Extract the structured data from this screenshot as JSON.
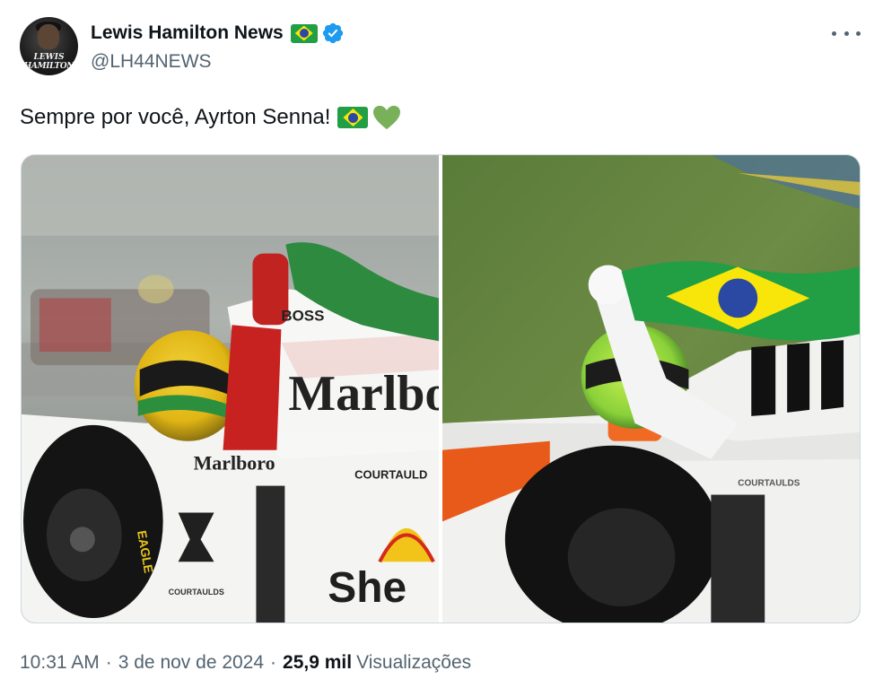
{
  "author": {
    "display_name": "Lewis Hamilton News",
    "handle": "@LH44NEWS",
    "avatar_text_line1": "LEWIS",
    "avatar_text_line2": "HAMILTON",
    "verified": true,
    "flag_icon": "brazil-flag-emoji",
    "badge_icon": "verified-badge-icon"
  },
  "tweet": {
    "text": "Sempre por você, Ayrton Senna!",
    "emojis": [
      "brazil-flag-emoji",
      "green-heart-emoji"
    ]
  },
  "media": {
    "left_photo_texts": [
      "BOSS",
      "Marlbo",
      "Marlboro",
      "COURTAULD",
      "She",
      "EAGLE",
      "COURTAULDS"
    ],
    "right_photo_texts": [
      "COURTAULDS"
    ]
  },
  "meta": {
    "time": "10:31 AM",
    "date": "3 de nov de 2024",
    "views_count": "25,9 mil",
    "views_label": "Visualizações",
    "separator": "·"
  },
  "colors": {
    "text_primary": "#0f1419",
    "text_secondary": "#536471",
    "verified_blue": "#1d9bf0",
    "heart_green": "#78b159",
    "border": "#cfd9de"
  }
}
